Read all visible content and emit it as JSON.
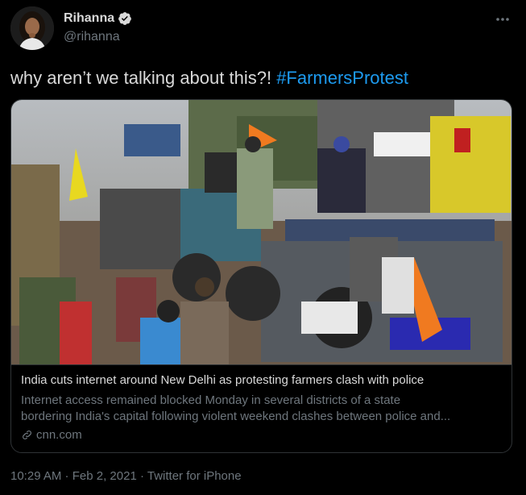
{
  "author": {
    "display_name": "Rihanna",
    "handle": "@rihanna",
    "verified_icon": "verified-badge-icon",
    "avatar_icon": "avatar"
  },
  "menu": {
    "icon": "more-horizontal-icon"
  },
  "tweet": {
    "text_prefix": "why aren’t we talking about this?! ",
    "hashtag": "#FarmersProtest"
  },
  "card": {
    "title": "India cuts internet around New Delhi as protesting farmers clash with police",
    "description_line1": "Internet access remained blocked Monday in several districts of a state",
    "description_line2": "bordering India's capital following violent weekend clashes between police and...",
    "domain": "cnn.com",
    "domain_icon": "link-icon"
  },
  "meta": {
    "time": "10:29 AM",
    "separator": " · ",
    "date": "Feb 2, 2021",
    "source": "Twitter for iPhone"
  },
  "colors": {
    "background": "#000000",
    "text": "#d9d9d9",
    "secondary": "#6e767d",
    "accent": "#1d9bf0",
    "border": "#2f3336"
  }
}
